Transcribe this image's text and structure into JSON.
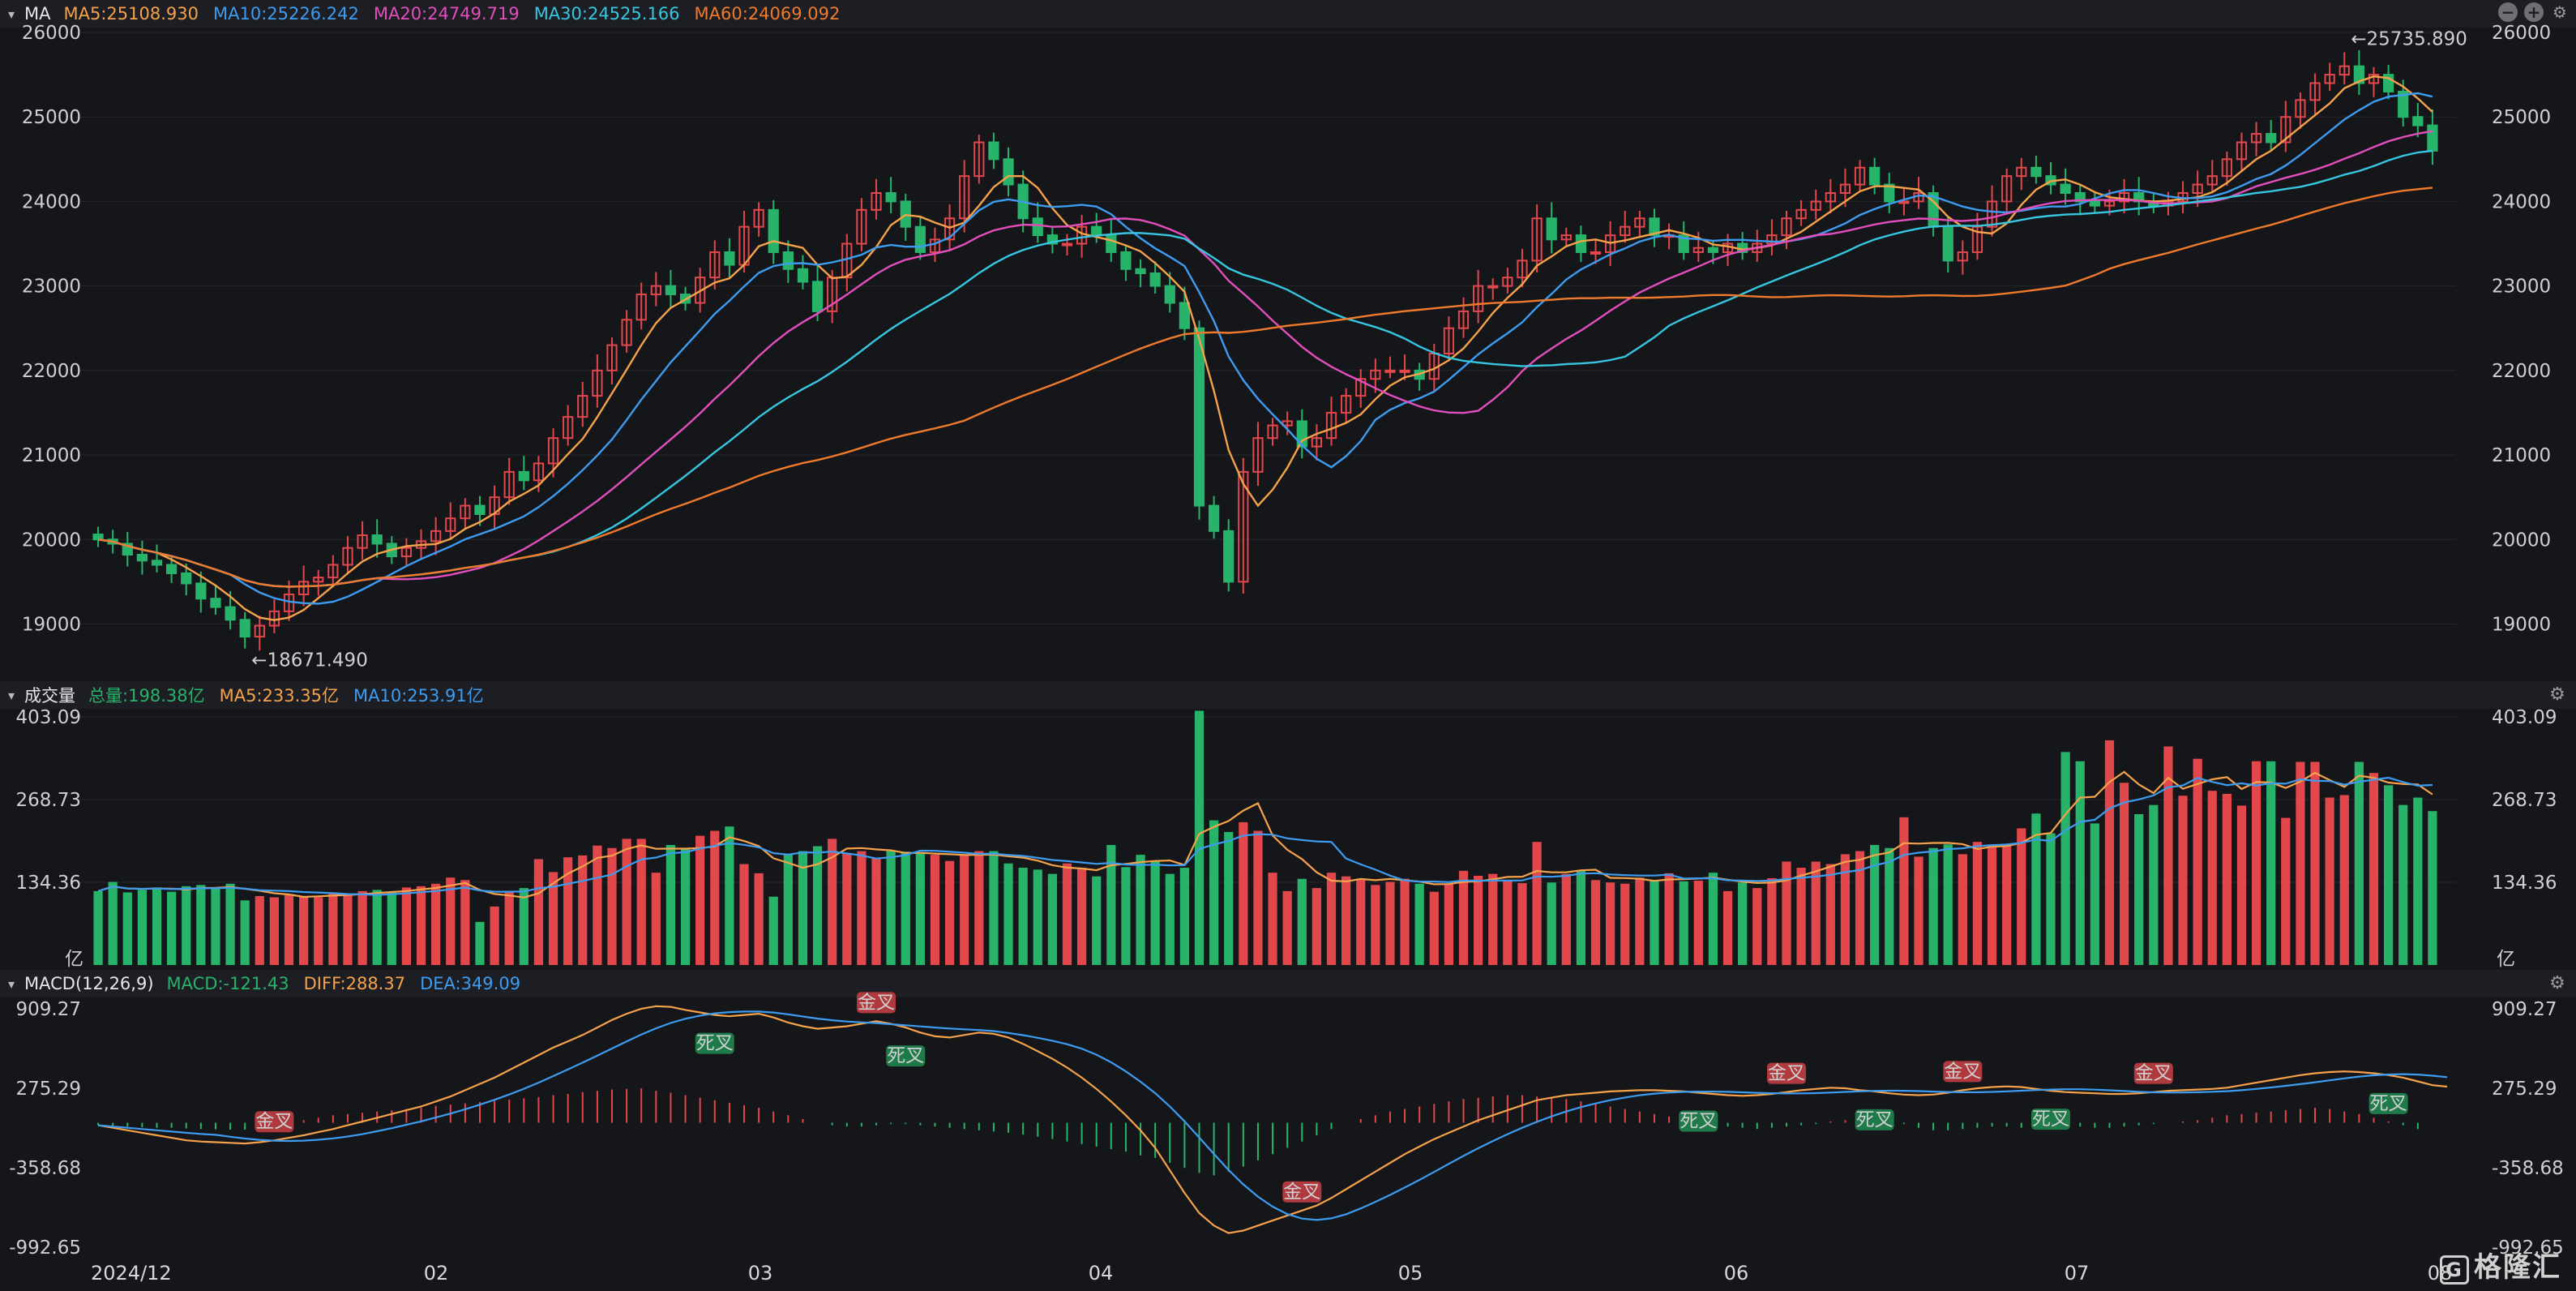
{
  "price_panel": {
    "name": "MA",
    "ma5": "MA5:25108.930",
    "ma10": "MA10:25226.242",
    "ma20": "MA20:24749.719",
    "ma30": "MA30:24525.166",
    "ma60": "MA60:24069.092",
    "high_note": "←25735.890",
    "low_note": "←18671.490"
  },
  "volume_panel": {
    "name": "成交量",
    "total": "总量:198.38亿",
    "ma5": "MA5:233.35亿",
    "ma10": "MA10:253.91亿",
    "unit": "亿"
  },
  "macd_panel": {
    "name": "MACD(12,26,9)",
    "macd": "MACD:-121.43",
    "diff": "DIFF:288.37",
    "dea": "DEA:349.09",
    "golden_cross": "金叉",
    "death_cross": "死叉"
  },
  "colors": {
    "up": "#e2474c",
    "down": "#27b36a",
    "ma5": "#f5a24a",
    "ma10": "#3d9cf0",
    "ma20": "#e24fbc",
    "ma30": "#36c6e0",
    "ma60": "#f07a2c"
  },
  "logo": "格隆汇",
  "chart_data": {
    "type": "candlestick",
    "x_ticks": [
      "2024/12",
      "02",
      "03",
      "04",
      "05",
      "06",
      "07",
      "08"
    ],
    "price_axis": {
      "ticks": [
        19000,
        20000,
        21000,
        22000,
        23000,
        24000,
        25000,
        26000
      ],
      "range": [
        18400,
        26000
      ]
    },
    "volume_axis": {
      "ticks": [
        "134.36",
        "268.73",
        "403.09"
      ],
      "range": [
        0,
        403.09
      ]
    },
    "macd_axis": {
      "ticks": [
        "909.27",
        "275.29",
        "-358.68",
        "-992.65"
      ],
      "range": [
        -992.65,
        909.27
      ]
    },
    "close": [
      20000,
      19950,
      19820,
      19750,
      19700,
      19600,
      19480,
      19300,
      19200,
      19050,
      18850,
      18980,
      19150,
      19350,
      19500,
      19550,
      19700,
      19900,
      20050,
      19950,
      19800,
      19900,
      19980,
      20100,
      20250,
      20400,
      20300,
      20500,
      20800,
      20700,
      20900,
      21200,
      21450,
      21700,
      22000,
      22300,
      22600,
      22900,
      23000,
      22900,
      22800,
      23100,
      23400,
      23250,
      23700,
      23900,
      23400,
      23200,
      23050,
      22700,
      23100,
      23500,
      23900,
      24100,
      24000,
      23700,
      23400,
      23550,
      23800,
      24300,
      24700,
      24500,
      24200,
      23800,
      23600,
      23500,
      23500,
      23700,
      23600,
      23400,
      23200,
      23150,
      23000,
      22800,
      22500,
      20400,
      20100,
      19500,
      20800,
      21200,
      21350,
      21400,
      21100,
      21200,
      21500,
      21700,
      21900,
      22000,
      22000,
      22000,
      21900,
      22200,
      22500,
      22700,
      23000,
      23000,
      23100,
      23300,
      23800,
      23550,
      23600,
      23400,
      23400,
      23600,
      23700,
      23800,
      23600,
      23600,
      23400,
      23450,
      23400,
      23500,
      23400,
      23500,
      23600,
      23800,
      23900,
      24000,
      24100,
      24200,
      24400,
      24200,
      24000,
      24000,
      24100,
      23700,
      23300,
      23400,
      23700,
      24000,
      24300,
      24400,
      24300,
      24200,
      24100,
      24000,
      23950,
      24000,
      24100,
      24000,
      23950,
      24000,
      24100,
      24200,
      24300,
      24500,
      24700,
      24800,
      24700,
      25000,
      25200,
      25400,
      25500,
      25600,
      25400,
      25500,
      25300,
      25000,
      24900,
      24600
    ],
    "volume": [
      120,
      135,
      118,
      122,
      126,
      119,
      128,
      130,
      124,
      132,
      105,
      112,
      110,
      114,
      112,
      110,
      118,
      115,
      120,
      122,
      118,
      126,
      128,
      132,
      142,
      138,
      70,
      95,
      120,
      125,
      172,
      151,
      175,
      178,
      194,
      190,
      205,
      205,
      150,
      195,
      190,
      210,
      218,
      225,
      164,
      149,
      111,
      181,
      185,
      193,
      205,
      182,
      185,
      174,
      185,
      184,
      183,
      179,
      169,
      179,
      185,
      185,
      165,
      158,
      155,
      148,
      165,
      158,
      144,
      195,
      159,
      179,
      168,
      148,
      158,
      413,
      235,
      216,
      232,
      218,
      150,
      120,
      140,
      125,
      150,
      144,
      140,
      130,
      135,
      140,
      132,
      119,
      131,
      153,
      145,
      148,
      138,
      133,
      200,
      134,
      148,
      154,
      138,
      134,
      132,
      142,
      138,
      149,
      136,
      137,
      150,
      120,
      134,
      125,
      141,
      168,
      158,
      168,
      164,
      180,
      185,
      195,
      190,
      240,
      176,
      190,
      196,
      180,
      200,
      195,
      195,
      222,
      246,
      214,
      346,
      331,
      230,
      365,
      296,
      245,
      260,
      355,
      275,
      335,
      283,
      278,
      259,
      331,
      331,
      239,
      330,
      330,
      272,
      276,
      330,
      312,
      292,
      260,
      272,
      250
    ],
    "macd": [
      -20,
      -25,
      -30,
      -35,
      -40,
      -40,
      -45,
      -50,
      -52,
      -55,
      -55,
      -40,
      -20,
      0,
      20,
      40,
      60,
      70,
      80,
      90,
      100,
      110,
      120,
      135,
      145,
      155,
      165,
      175,
      185,
      195,
      205,
      220,
      230,
      245,
      255,
      265,
      270,
      275,
      255,
      240,
      220,
      200,
      180,
      160,
      140,
      120,
      90,
      60,
      30,
      0,
      -20,
      -30,
      -30,
      -20,
      -10,
      -10,
      -20,
      -30,
      -40,
      -50,
      -60,
      -70,
      -80,
      -95,
      -110,
      -130,
      -150,
      -170,
      -190,
      -210,
      -230,
      -260,
      -280,
      -320,
      -360,
      -400,
      -420,
      -390,
      -350,
      -300,
      -250,
      -200,
      -150,
      -100,
      -50,
      0,
      30,
      60,
      90,
      110,
      130,
      150,
      170,
      190,
      200,
      210,
      220,
      220,
      210,
      200,
      190,
      170,
      150,
      130,
      110,
      90,
      70,
      50,
      30,
      10,
      -10,
      -30,
      -40,
      -50,
      -40,
      -30,
      -20,
      -10,
      10,
      20,
      30,
      20,
      10,
      -10,
      -40,
      -60,
      -60,
      -50,
      -40,
      -30,
      -30,
      -40,
      -40,
      -30,
      -20,
      -30,
      -40,
      -40,
      -30,
      -20,
      -10,
      0,
      10,
      20,
      40,
      60,
      70,
      80,
      90,
      100,
      110,
      120,
      110,
      90,
      70,
      40,
      10,
      -20,
      -50
    ],
    "diff": [
      -20,
      -40,
      -60,
      -80,
      -100,
      -120,
      -140,
      -150,
      -155,
      -160,
      -165,
      -155,
      -140,
      -120,
      -100,
      -75,
      -50,
      -20,
      10,
      40,
      70,
      100,
      130,
      170,
      210,
      260,
      310,
      360,
      420,
      480,
      540,
      600,
      650,
      700,
      760,
      820,
      870,
      910,
      930,
      925,
      900,
      880,
      860,
      850,
      860,
      870,
      840,
      800,
      770,
      750,
      760,
      770,
      790,
      810,
      790,
      760,
      720,
      690,
      680,
      700,
      720,
      710,
      680,
      630,
      570,
      510,
      440,
      360,
      270,
      170,
      60,
      -60,
      -200,
      -380,
      -560,
      -720,
      -820,
      -880,
      -860,
      -820,
      -780,
      -740,
      -700,
      -660,
      -600,
      -530,
      -460,
      -390,
      -320,
      -250,
      -190,
      -130,
      -80,
      -30,
      20,
      60,
      100,
      140,
      180,
      200,
      220,
      230,
      240,
      250,
      255,
      260,
      260,
      255,
      250,
      240,
      230,
      220,
      215,
      220,
      230,
      245,
      260,
      270,
      280,
      275,
      260,
      250,
      235,
      225,
      220,
      225,
      240,
      260,
      275,
      285,
      290,
      285,
      270,
      255,
      245,
      240,
      235,
      230,
      230,
      235,
      245,
      255,
      260,
      265,
      270,
      280,
      300,
      320,
      340,
      360,
      380,
      395,
      405,
      410,
      405,
      395,
      380,
      360,
      330,
      300,
      288
    ]
  }
}
